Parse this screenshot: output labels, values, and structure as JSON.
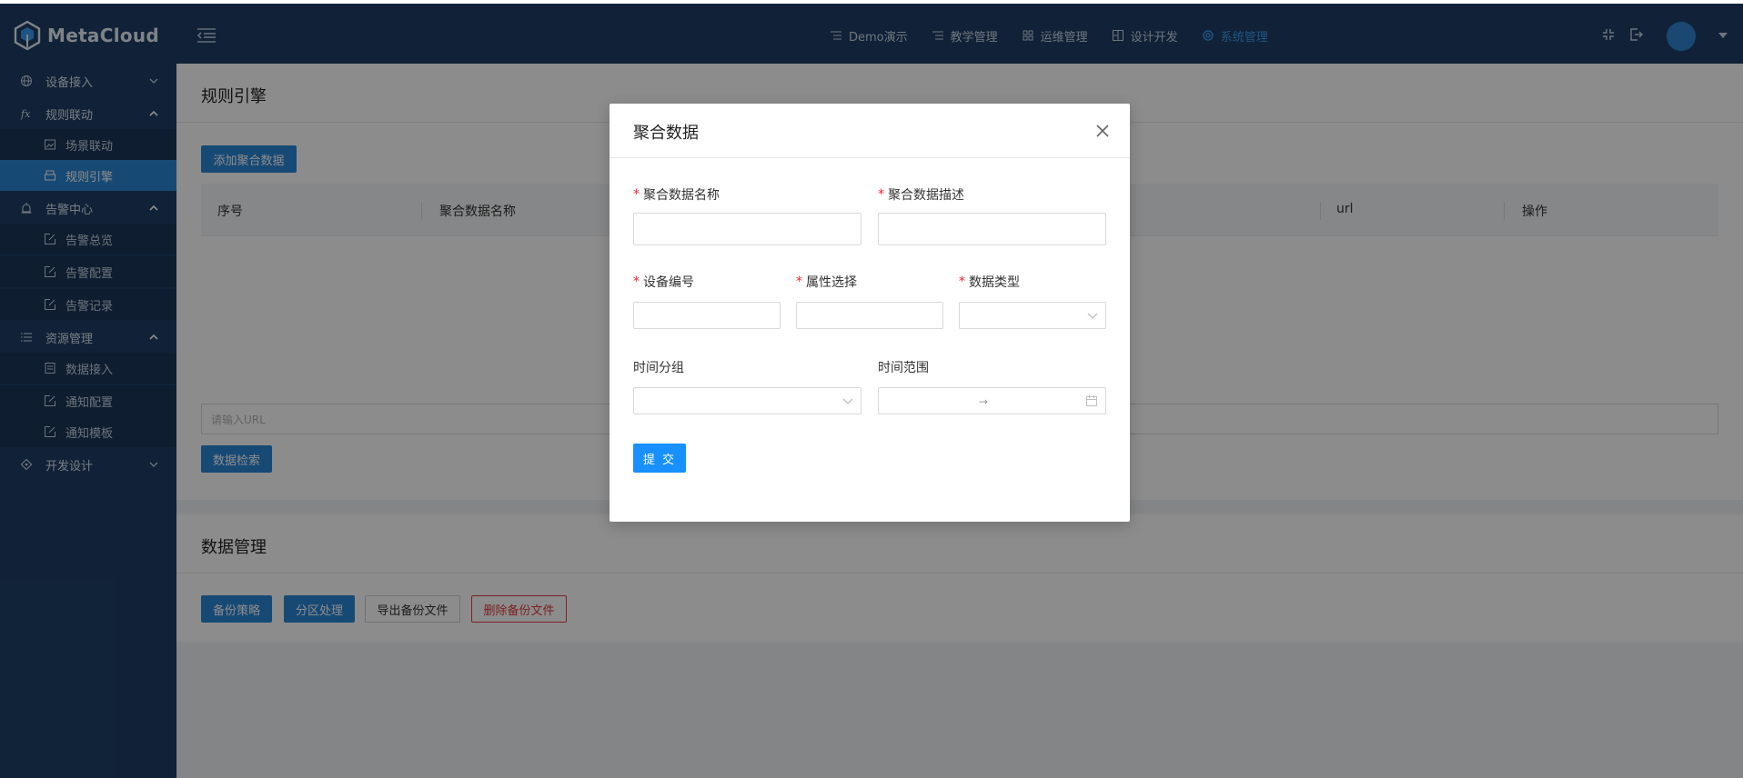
{
  "app": {
    "name": "MetaCloud"
  },
  "top_nav": [
    {
      "label": "Demo演示",
      "icon": "list-icon",
      "active": false
    },
    {
      "label": "教学管理",
      "icon": "list-icon",
      "active": false
    },
    {
      "label": "运维管理",
      "icon": "grid-icon",
      "active": false
    },
    {
      "label": "设计开发",
      "icon": "layout-icon",
      "active": false
    },
    {
      "label": "系统管理",
      "icon": "gear-icon",
      "active": true
    }
  ],
  "sidebar": {
    "items": [
      {
        "label": "设备接入",
        "type": "group",
        "expanded": false,
        "icon": "globe-icon"
      },
      {
        "label": "规则联动",
        "type": "group",
        "expanded": true,
        "icon": "function-icon"
      },
      {
        "label": "场景联动",
        "type": "sub",
        "icon": "image-icon"
      },
      {
        "label": "规则引擎",
        "type": "sub",
        "active": true,
        "icon": "print-icon"
      },
      {
        "label": "告警中心",
        "type": "group",
        "expanded": true,
        "icon": "alarm-icon"
      },
      {
        "label": "告警总览",
        "type": "sub",
        "icon": "edit-icon"
      },
      {
        "label": "告警配置",
        "type": "sub",
        "icon": "edit-icon"
      },
      {
        "label": "告警记录",
        "type": "sub",
        "icon": "edit-icon"
      },
      {
        "label": "资源管理",
        "type": "group",
        "expanded": true,
        "icon": "list-icon"
      },
      {
        "label": "数据接入",
        "type": "sub",
        "icon": "doc-icon"
      },
      {
        "label": "通知配置",
        "type": "sub",
        "icon": "edit-icon"
      },
      {
        "label": "通知模板",
        "type": "sub",
        "icon": "edit-icon"
      },
      {
        "label": "开发设计",
        "type": "group",
        "expanded": false,
        "icon": "diamond-icon"
      }
    ]
  },
  "rule_engine": {
    "title": "规则引擎",
    "add_button": "添加聚合数据",
    "table_headers": [
      "序号",
      "聚合数据名称",
      "url",
      "操作"
    ],
    "url_placeholder": "请输入URL",
    "search_button": "数据检索"
  },
  "data_management": {
    "title": "数据管理",
    "buttons": {
      "backup_policy": "备份策略",
      "partition": "分区处理",
      "export": "导出备份文件",
      "delete": "删除备份文件"
    }
  },
  "modal": {
    "title": "聚合数据",
    "fields": {
      "name": {
        "label": "聚合数据名称",
        "required": true,
        "value": ""
      },
      "desc": {
        "label": "聚合数据描述",
        "required": true,
        "value": ""
      },
      "device_no": {
        "label": "设备编号",
        "required": true,
        "value": ""
      },
      "attribute": {
        "label": "属性选择",
        "required": true,
        "value": ""
      },
      "data_type": {
        "label": "数据类型",
        "required": true,
        "value": ""
      },
      "time_group": {
        "label": "时间分组",
        "required": false,
        "value": ""
      },
      "time_range": {
        "label": "时间范围",
        "required": false,
        "separator": "→"
      }
    },
    "required_mark": "*",
    "submit": "提 交"
  },
  "colors": {
    "nav_bg": "#1f3f66",
    "primary": "#2a86d6",
    "submit": "#1890ff",
    "danger": "#e03c3c",
    "active_nav": "#3a9cf0"
  }
}
